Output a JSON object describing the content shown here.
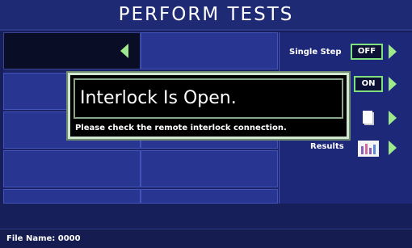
{
  "header": {
    "title": "PERFORM TESTS"
  },
  "side_panel": {
    "single_step_label": "Single Step",
    "single_step_value": "OFF",
    "second_toggle_value": "ON",
    "results_label": "Results",
    "icons": [
      "document-icon",
      "results-chart-icon"
    ],
    "accent_color": "#9ee98c"
  },
  "dialog": {
    "title": "Interlock Is Open.",
    "message": "Please check the remote interlock connection."
  },
  "status": {
    "file_name_label": "File Name:",
    "file_name_value": "0000"
  }
}
